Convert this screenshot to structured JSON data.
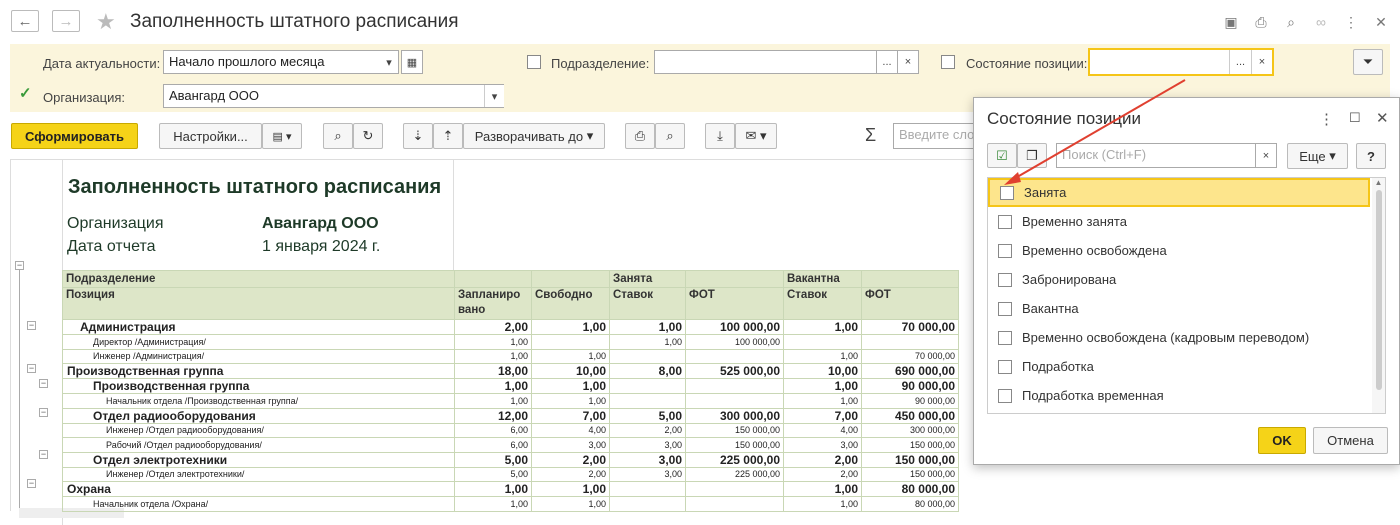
{
  "window": {
    "title": "Заполненность штатного расписания"
  },
  "filters": {
    "date_label": "Дата актуальности:",
    "date_value": "Начало прошлого месяца",
    "division_label": "Подразделение:",
    "state_label": "Состояние позиции:",
    "org_label": "Организация:",
    "org_value": "Авангард ООО",
    "more": "...",
    "clear": "×"
  },
  "toolbar": {
    "generate": "Сформировать",
    "settings": "Настройки...",
    "expand": "Разворачивать до",
    "search_placeholder": "Введите сло",
    "sigma": "Σ"
  },
  "report": {
    "title": "Заполненность штатного расписания",
    "org_key": "Организация",
    "org_val": "Авангард ООО",
    "date_key": "Дата отчета",
    "date_val": "1 января 2024 г.",
    "head1": [
      "Подразделение",
      "",
      "",
      "Занята",
      "",
      "Вакантна",
      ""
    ],
    "head2": [
      "Позиция",
      "Запланиро\nвано",
      "Свободно",
      "Ставок",
      "ФОТ",
      "Ставок",
      "ФОТ"
    ],
    "rows": [
      {
        "b": true,
        "lvl": 1,
        "c": [
          "Администрация",
          "2,00",
          "1,00",
          "1,00",
          "100 000,00",
          "1,00",
          "70 000,00"
        ]
      },
      {
        "b": false,
        "lvl": 2,
        "c": [
          "Директор /Администрация/",
          "1,00",
          "",
          "1,00",
          "100 000,00",
          "",
          ""
        ]
      },
      {
        "b": false,
        "lvl": 2,
        "c": [
          "Инженер /Администрация/",
          "1,00",
          "1,00",
          "",
          "",
          "1,00",
          "70 000,00"
        ]
      },
      {
        "b": true,
        "lvl": 0,
        "c": [
          "Производственная группа",
          "18,00",
          "10,00",
          "8,00",
          "525 000,00",
          "10,00",
          "690 000,00"
        ]
      },
      {
        "b": true,
        "lvl": 2,
        "c": [
          "Производственная группа",
          "1,00",
          "1,00",
          "",
          "",
          "1,00",
          "90 000,00"
        ]
      },
      {
        "b": false,
        "lvl": 3,
        "c": [
          "Начальник отдела /Производственная группа/",
          "1,00",
          "1,00",
          "",
          "",
          "1,00",
          "90 000,00"
        ]
      },
      {
        "b": true,
        "lvl": 2,
        "c": [
          "Отдел радиооборудования",
          "12,00",
          "7,00",
          "5,00",
          "300 000,00",
          "7,00",
          "450 000,00"
        ]
      },
      {
        "b": false,
        "lvl": 3,
        "c": [
          "Инженер /Отдел радиооборудования/",
          "6,00",
          "4,00",
          "2,00",
          "150 000,00",
          "4,00",
          "300 000,00"
        ]
      },
      {
        "b": false,
        "lvl": 3,
        "c": [
          "Рабочий /Отдел радиооборудования/",
          "6,00",
          "3,00",
          "3,00",
          "150 000,00",
          "3,00",
          "150 000,00"
        ]
      },
      {
        "b": true,
        "lvl": 2,
        "c": [
          "Отдел электротехники",
          "5,00",
          "2,00",
          "3,00",
          "225 000,00",
          "2,00",
          "150 000,00"
        ]
      },
      {
        "b": false,
        "lvl": 3,
        "c": [
          "Инженер /Отдел электротехники/",
          "5,00",
          "2,00",
          "3,00",
          "225 000,00",
          "2,00",
          "150 000,00"
        ]
      },
      {
        "b": true,
        "lvl": 0,
        "c": [
          "Охрана",
          "1,00",
          "1,00",
          "",
          "",
          "1,00",
          "80 000,00"
        ]
      },
      {
        "b": false,
        "lvl": 2,
        "c": [
          "Начальник отдела /Охрана/",
          "1,00",
          "1,00",
          "",
          "",
          "1,00",
          "80 000,00"
        ]
      }
    ]
  },
  "popup": {
    "title": "Состояние позиции",
    "search_placeholder": "Поиск (Ctrl+F)",
    "more": "Еще",
    "help": "?",
    "ok": "OK",
    "cancel": "Отмена",
    "items": [
      "Занята",
      "Временно занята",
      "Временно освобождена",
      "Забронирована",
      "Вакантна",
      "Временно освобождена (кадровым переводом)",
      "Подработка",
      "Подработка временная"
    ]
  },
  "colors": {
    "accent": "#f5d318",
    "filter_bg": "#fbf5dc",
    "header_bg": "#dde6c8",
    "highlight": "#fde58c"
  }
}
